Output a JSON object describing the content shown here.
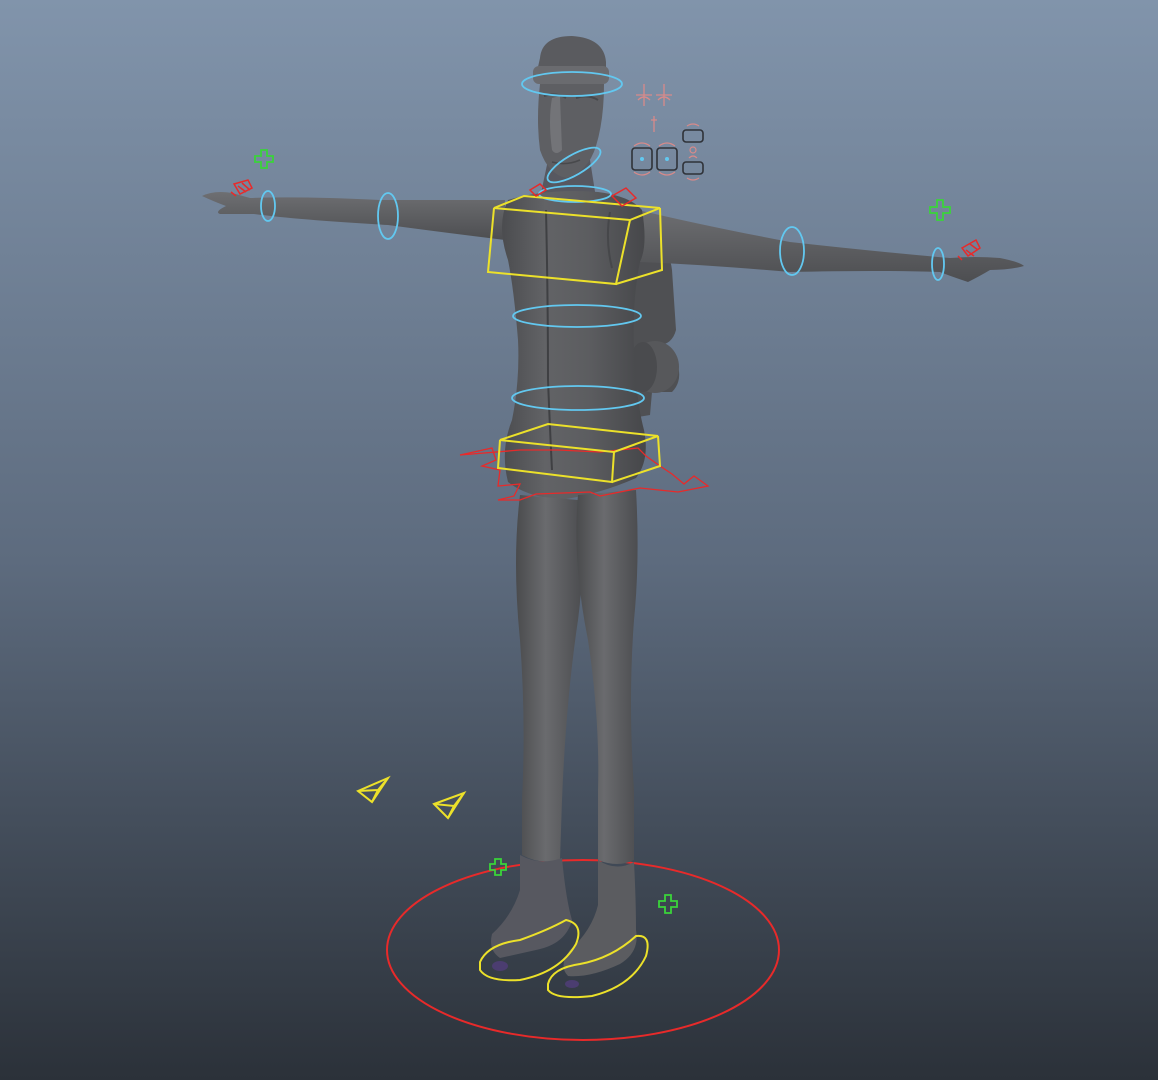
{
  "viewport": {
    "gradient_top": "#8194ab",
    "gradient_mid": "#5d6b7e",
    "gradient_bottom": "#2b3139"
  },
  "colors": {
    "mesh_fill": "#5f6062",
    "mesh_shade": "#4a4b4d",
    "mesh_highlight": "#76777a",
    "fk_control": "#62c8f0",
    "ik_box": "#ece12a",
    "root_and_hand": "#e82a2a",
    "pole_vector": "#3ad43a",
    "facial_panel": "#d88a8a",
    "facial_panel_dark": "#2f3238"
  },
  "icons": {
    "pole_vector": "plus-outline-icon",
    "ik_target": "pyramid-wireframe-icon"
  }
}
